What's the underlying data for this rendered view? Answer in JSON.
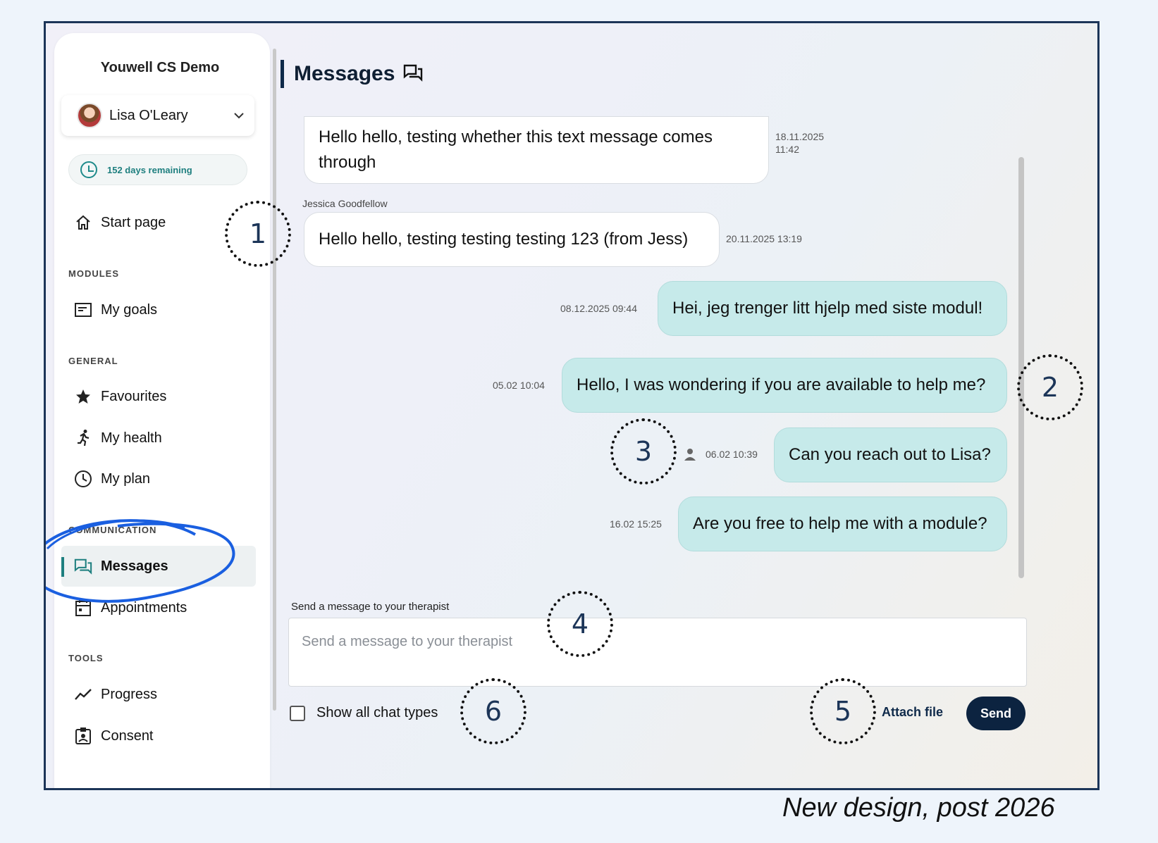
{
  "sidebar": {
    "app_title": "Youwell CS Demo",
    "user_name": "Lisa O'Leary",
    "days_remaining": "152 days remaining",
    "start_page": "Start page",
    "sections": {
      "modules": "MODULES",
      "general": "GENERAL",
      "communication": "COMMUNICATION",
      "tools": "TOOLS"
    },
    "items": {
      "my_goals": "My goals",
      "favourites": "Favourites",
      "my_health": "My health",
      "my_plan": "My plan",
      "messages": "Messages",
      "appointments": "Appointments",
      "progress": "Progress",
      "consent": "Consent"
    }
  },
  "main": {
    "title": "Messages",
    "messages": [
      {
        "text": "Hello hello, testing whether this text message comes through",
        "line1": "Hello hello, testing whether this text message comes",
        "line2": "through",
        "date": "18.11.2025",
        "time": "11:42"
      },
      {
        "sender": "Jessica Goodfellow",
        "text": "Hello hello, testing testing testing 123 (from Jess)",
        "timestamp": "20.11.2025 13:19"
      },
      {
        "text": "Hei, jeg trenger litt hjelp med siste modul!",
        "timestamp": "08.12.2025 09:44"
      },
      {
        "text": "Hello, I was wondering if you are available to help me?",
        "timestamp": "05.02 10:04"
      },
      {
        "text": "Can you reach out to Lisa?",
        "timestamp": "06.02 10:39"
      },
      {
        "text": "Are you free to help me with a module?",
        "timestamp": "16.02 15:25"
      }
    ],
    "compose_label": "Send a message to your therapist",
    "compose_placeholder": "Send a message to your therapist",
    "show_all_chat_types": "Show all chat types",
    "attach_file": "Attach file",
    "send": "Send"
  },
  "callouts": [
    "1",
    "2",
    "3",
    "4",
    "5",
    "6"
  ],
  "caption": "New design, post 2026",
  "colors": {
    "frame_border": "#1c3558",
    "accent_teal": "#1e7f7f",
    "outgoing_bubble": "#c6eaea",
    "send_button": "#0c2340",
    "highlight_scribble": "#1a5fe0"
  }
}
